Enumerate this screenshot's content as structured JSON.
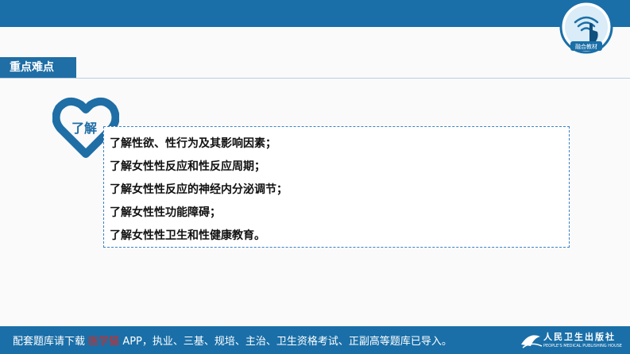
{
  "badge": {
    "label": "融合教材",
    "icon": "wifi-hand-icon"
  },
  "section": {
    "title": "重点难点"
  },
  "heart_label": "了解",
  "items": [
    "了解性欲、性行为及其影响因素；",
    "了解女性性反应和性反应周期；",
    "了解女性性反应的神经内分泌调节；",
    "了解女性性功能障碍；",
    "了解女性性卫生和性健康教育。"
  ],
  "footer": {
    "prefix": "配套题库请下载",
    "app_name": "医学猫",
    "suffix": "APP，执业、三基、规培、主治、卫生资格考试、正副高等题库已导入。"
  },
  "publisher": {
    "name": "人民卫生出版社",
    "subtitle": "PEOPLE'S MEDICAL PUBLISHING HOUSE"
  },
  "colors": {
    "primary": "#1a6fa8",
    "accent_red": "#e1251b"
  }
}
